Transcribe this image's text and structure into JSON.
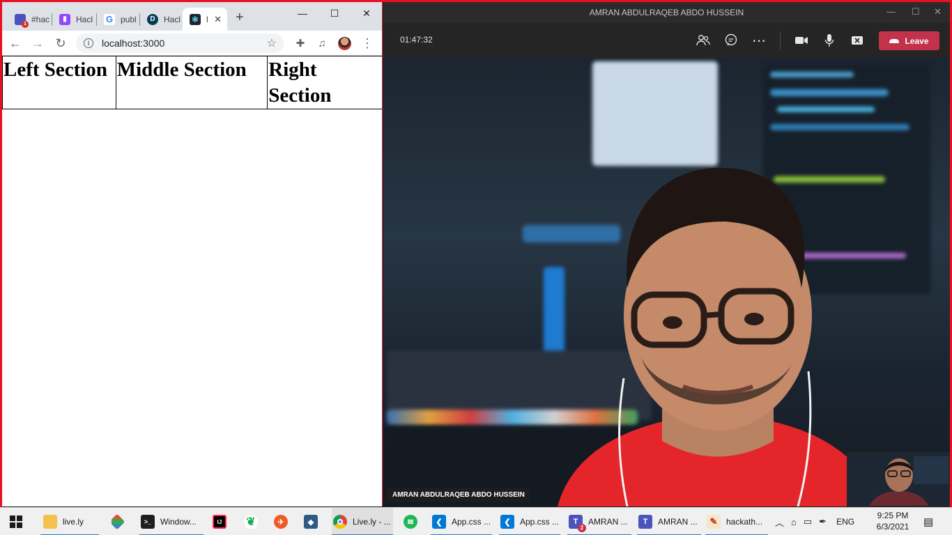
{
  "browser": {
    "tabs": [
      {
        "icon": "teams-icon",
        "title": "#hac",
        "badge": "1"
      },
      {
        "icon": "twitch-icon",
        "title": "Hacl"
      },
      {
        "icon": "google-icon",
        "title": "publ"
      },
      {
        "icon": "devpost-icon",
        "title": "Hacl"
      },
      {
        "icon": "react-icon",
        "title": "l",
        "active": true
      }
    ],
    "url": "localhost:3000",
    "page": {
      "columns": [
        "Left Section",
        "Middle Section",
        "Right Section"
      ]
    }
  },
  "teams": {
    "window_title": "AMRAN ABDULRAQEB ABDO HUSSEIN",
    "timer": "01:47:32",
    "leave_label": "Leave",
    "participant_name": "AMRAN ABDULRAQEB ABDO HUSSEIN",
    "accent_color": "#c4314b"
  },
  "taskbar": {
    "items": [
      {
        "icon": "file-explorer-icon",
        "label": "live.ly"
      },
      {
        "icon": "git-icon",
        "label": ""
      },
      {
        "icon": "terminal-icon",
        "label": "Window..."
      },
      {
        "icon": "intellij-icon",
        "label": ""
      },
      {
        "icon": "mongodb-icon",
        "label": ""
      },
      {
        "icon": "postman-icon",
        "label": ""
      },
      {
        "icon": "mysql-workbench-icon",
        "label": ""
      },
      {
        "icon": "chrome-icon",
        "label": "Live.ly - ..."
      },
      {
        "icon": "spotify-icon",
        "label": ""
      },
      {
        "icon": "vscode-icon",
        "label": "App.css ..."
      },
      {
        "icon": "vscode-icon",
        "label": "App.css ..."
      },
      {
        "icon": "teams-icon",
        "label": "AMRAN ...",
        "badge": "2"
      },
      {
        "icon": "teams-icon",
        "label": "AMRAN ..."
      },
      {
        "icon": "paint-icon",
        "label": "hackath..."
      }
    ],
    "language": "ENG",
    "time": "9:25 PM",
    "date": "6/3/2021"
  }
}
